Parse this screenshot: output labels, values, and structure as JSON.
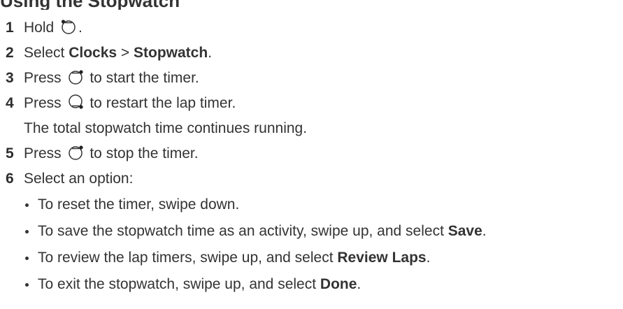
{
  "heading_fragment": "Using the Stopwatch",
  "steps": [
    {
      "num": "1",
      "pre": "Hold ",
      "icon": "top-left-button-icon",
      "post": "."
    },
    {
      "num": "2",
      "pre": "Select ",
      "b1": "Clocks",
      "mid": " > ",
      "b2": "Stopwatch",
      "post": "."
    },
    {
      "num": "3",
      "pre": "Press ",
      "icon": "top-right-button-icon",
      "post": " to start the timer."
    },
    {
      "num": "4",
      "pre": "Press ",
      "icon": "bottom-right-button-icon",
      "post": " to restart the lap timer."
    },
    {
      "num": "5",
      "pre": "Press ",
      "icon": "top-right-button-icon",
      "post": " to stop the timer."
    },
    {
      "num": "6",
      "text": "Select an option:"
    }
  ],
  "step4_note": "The total stopwatch time continues running.",
  "options": [
    {
      "pre": "To reset the timer, swipe down."
    },
    {
      "pre": "To save the stopwatch time as an activity, swipe up, and select ",
      "bold": "Save",
      "post": "."
    },
    {
      "pre": "To review the lap timers, swipe up, and select ",
      "bold": "Review Laps",
      "post": "."
    },
    {
      "pre": "To exit the stopwatch, swipe up, and select ",
      "bold": "Done",
      "post": "."
    }
  ]
}
